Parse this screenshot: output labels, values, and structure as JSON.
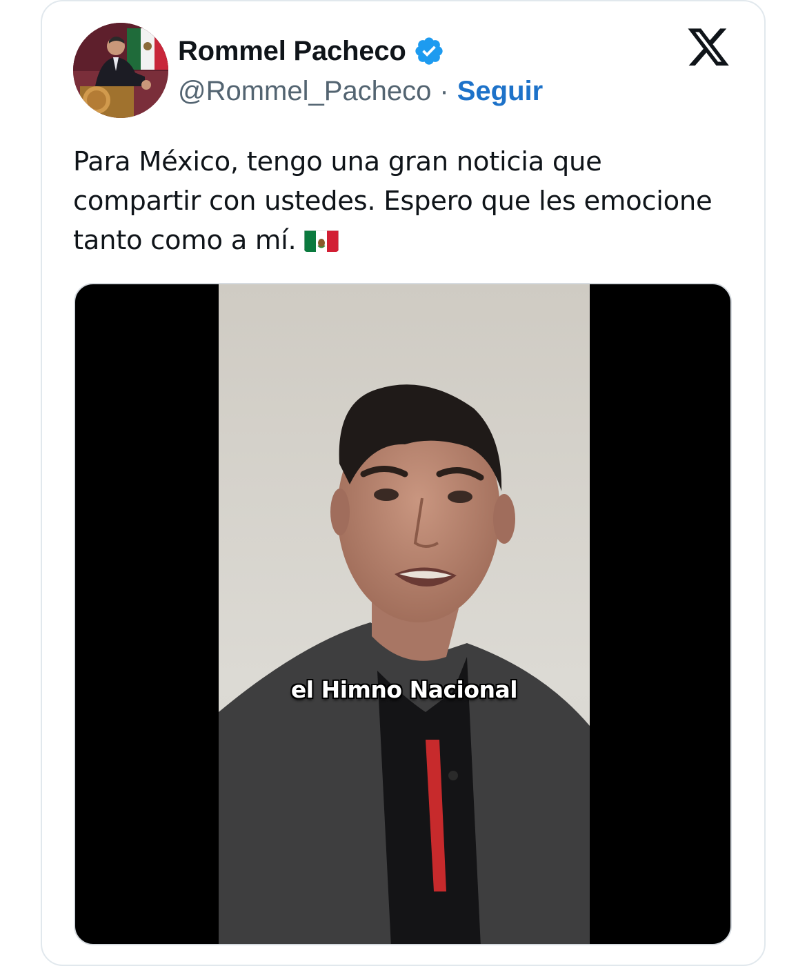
{
  "tweet": {
    "author": {
      "display_name": "Rommel Pacheco",
      "handle": "@Rommel_Pacheco",
      "verified": true,
      "avatar_icon": "profile-photo"
    },
    "separator": "·",
    "follow_label": "Seguir",
    "platform_icon": "x-logo-icon",
    "text": "Para México, tengo una gran noticia que compartir con ustedes. Espero que les emocione tanto como a mí.",
    "emoji": "mexico-flag-icon",
    "media": {
      "type": "video",
      "caption": "el Himno Nacional"
    }
  },
  "colors": {
    "accent": "#1d72c9",
    "verified_badge": "#1d9bf0",
    "text": "#0f1419",
    "secondary_text": "#536471",
    "border": "#e1e8ed"
  }
}
